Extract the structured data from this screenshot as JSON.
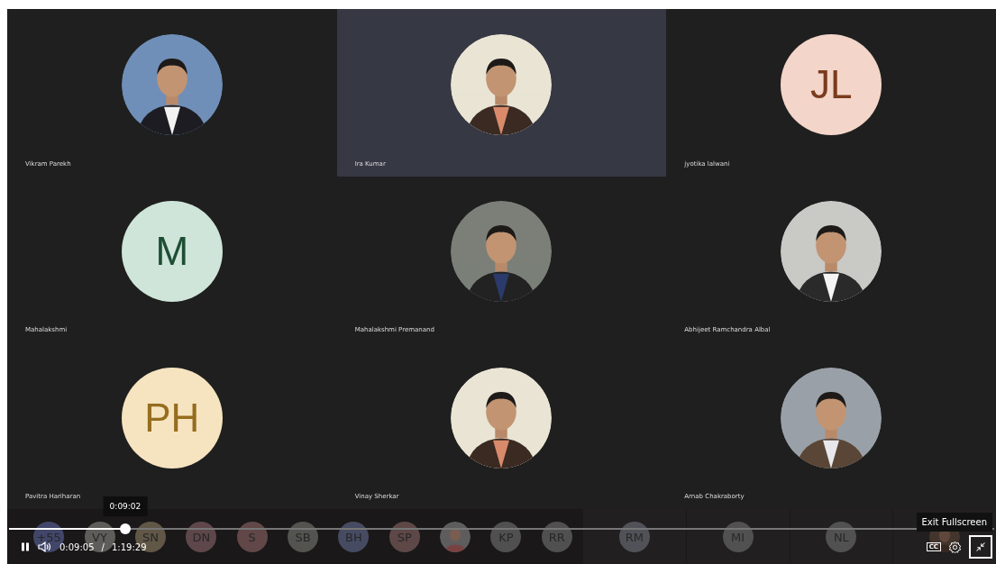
{
  "tiles": [
    {
      "name": "Vikram Parekh",
      "kind": "picture",
      "selected": false
    },
    {
      "name": "Ira Kumar",
      "kind": "picture",
      "selected": true
    },
    {
      "name": "jyotika lalwani",
      "kind": "initials",
      "initials": "JL",
      "color": "#f3d6c9",
      "selected": false
    },
    {
      "name": "Mahalakshmi",
      "kind": "initials",
      "initials": "M",
      "color": "#cfe5d9",
      "selected": false
    },
    {
      "name": "Mahalakshmi Premanand",
      "kind": "picture",
      "selected": false
    },
    {
      "name": "Abhijeet Ramchandra Albal",
      "kind": "picture",
      "selected": false
    },
    {
      "name": "Pavitra Hariharan",
      "kind": "initials",
      "initials": "PH",
      "color": "#f6e4c0",
      "selected": false
    },
    {
      "name": "Vinay Sherkar",
      "kind": "picture",
      "selected": false
    },
    {
      "name": "Arnab Chakraborty",
      "kind": "picture",
      "selected": false
    }
  ],
  "strip_avatars": [
    {
      "kind": "initials",
      "initials": "+55",
      "color": "#4a4f78"
    },
    {
      "kind": "initials",
      "initials": "VY",
      "color": "#6a6a66"
    },
    {
      "kind": "initials",
      "initials": "SN",
      "color": "#6e6250"
    },
    {
      "kind": "initials",
      "initials": "DN",
      "color": "#6a5054"
    },
    {
      "kind": "initials",
      "initials": "S",
      "color": "#6e5050"
    },
    {
      "kind": "initials",
      "initials": "SB",
      "color": "#5e5e5a"
    },
    {
      "kind": "initials",
      "initials": "BH",
      "color": "#4e5470"
    },
    {
      "kind": "initials",
      "initials": "SP",
      "color": "#6a5050"
    },
    {
      "kind": "picture"
    },
    {
      "kind": "initials",
      "initials": "KP",
      "color": "#5a5a5a"
    },
    {
      "kind": "initials",
      "initials": "RR",
      "color": "#5a5a5a"
    }
  ],
  "strip_tiles": [
    {
      "kind": "initials",
      "initials": "RM",
      "color": "#5a5a62"
    },
    {
      "kind": "initials",
      "initials": "MI",
      "color": "#5a5a5a"
    },
    {
      "kind": "initials",
      "initials": "NL",
      "color": "#5a5a5a"
    },
    {
      "kind": "picture"
    }
  ],
  "player": {
    "level": 0.118,
    "hover_time": "0:09:02",
    "current_time": "0:09:05",
    "separator": "/",
    "duration": "1:19:29",
    "cc": "CC",
    "tooltip": "Exit Fullscreen"
  }
}
